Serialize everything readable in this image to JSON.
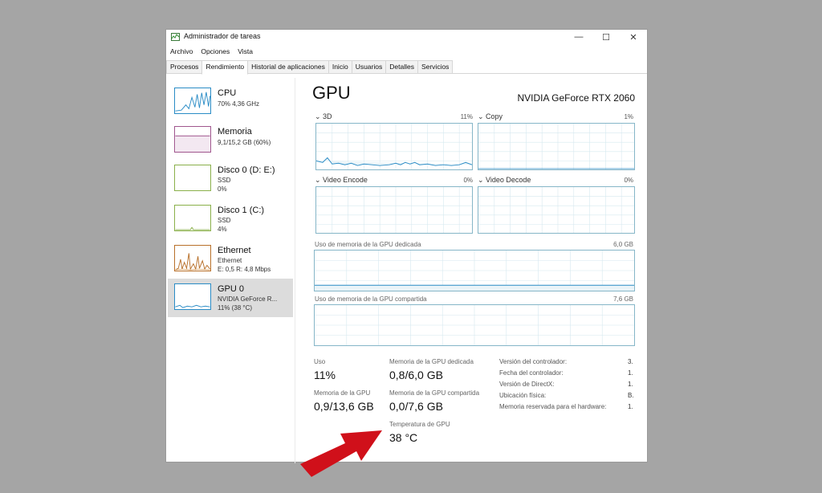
{
  "window": {
    "title": "Administrador de tareas",
    "controls": {
      "minimize": "—",
      "maximize": "☐",
      "close": "✕"
    }
  },
  "menu": [
    "Archivo",
    "Opciones",
    "Vista"
  ],
  "tabs": [
    "Procesos",
    "Rendimiento",
    "Historial de aplicaciones",
    "Inicio",
    "Usuarios",
    "Detalles",
    "Servicios"
  ],
  "active_tab": "Rendimiento",
  "sidebar": [
    {
      "name": "CPU",
      "lines": [
        "70% 4,36 GHz"
      ]
    },
    {
      "name": "Memoria",
      "lines": [
        "9,1/15,2 GB (60%)"
      ]
    },
    {
      "name": "Disco 0 (D: E:)",
      "lines": [
        "SSD",
        "0%"
      ]
    },
    {
      "name": "Disco 1 (C:)",
      "lines": [
        "SSD",
        "4%"
      ]
    },
    {
      "name": "Ethernet",
      "lines": [
        "Ethernet",
        "E: 0,5 R: 4,8 Mbps"
      ]
    },
    {
      "name": "GPU 0",
      "lines": [
        "NVIDIA GeForce R...",
        "11% (38 °C)"
      ]
    }
  ],
  "gpu": {
    "title": "GPU",
    "model": "NVIDIA GeForce RTX 2060",
    "engines": [
      {
        "label": "3D",
        "percent": "11%"
      },
      {
        "label": "Copy",
        "percent": "1%"
      },
      {
        "label": "Video Encode",
        "percent": "0%"
      },
      {
        "label": "Video Decode",
        "percent": "0%"
      }
    ],
    "dedicated_label": "Uso de memoria de la GPU dedicada",
    "dedicated_max": "6,0 GB",
    "shared_label": "Uso de memoria de la GPU compartida",
    "shared_max": "7,6 GB",
    "stats": {
      "usage_label": "Uso",
      "usage_value": "11%",
      "gpu_mem_label": "Memoria de la GPU",
      "gpu_mem_value": "0,9/13,6 GB",
      "dedicated_mem_label": "Memoria de la GPU dedicada",
      "dedicated_mem_value": "0,8/6,0 GB",
      "shared_mem_label": "Memoria de la GPU compartida",
      "shared_mem_value": "0,0/7,6 GB",
      "temp_label": "Temperatura de GPU",
      "temp_value": "38 °C"
    },
    "info": [
      {
        "label": "Versión del controlador:",
        "value": "3."
      },
      {
        "label": "Fecha del controlador:",
        "value": "1."
      },
      {
        "label": "Versión de DirectX:",
        "value": "1."
      },
      {
        "label": "Ubicación física:",
        "value": "B."
      },
      {
        "label": "Memoria reservada para el hardware:",
        "value": "1."
      }
    ]
  },
  "colors": {
    "graph_border": "#86b6c8",
    "arrow": "#d0101a"
  }
}
